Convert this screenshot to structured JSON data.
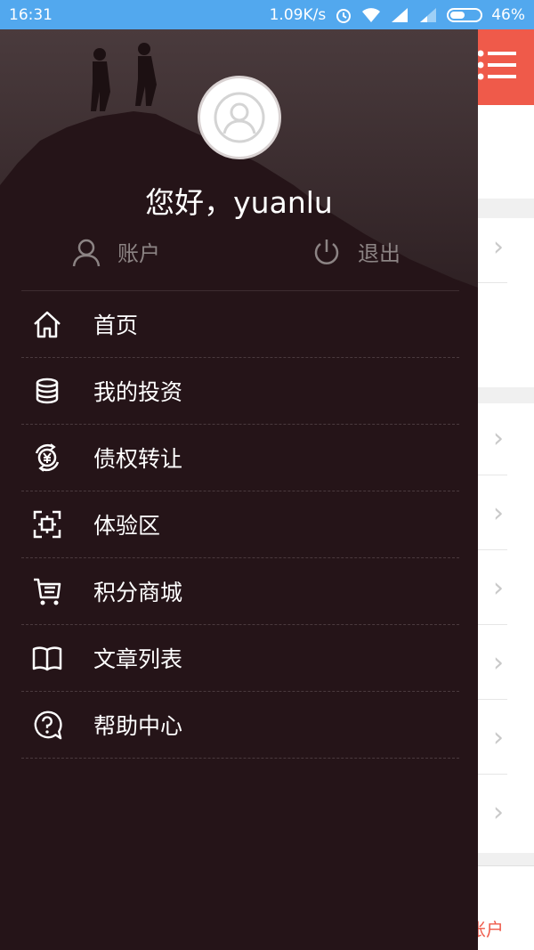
{
  "status_bar": {
    "time": "16:31",
    "network_speed": "1.09K/s",
    "battery": "46%",
    "icons": [
      "alarm-icon",
      "wifi-icon",
      "signal-icon",
      "signal-weak-icon",
      "battery-icon"
    ]
  },
  "drawer": {
    "greeting": "您好，yuanlu",
    "account_label": "账户",
    "logout_label": "退出",
    "menu": [
      {
        "label": "首页",
        "icon": "home-icon"
      },
      {
        "label": "我的投资",
        "icon": "coins-stack-icon"
      },
      {
        "label": "债权转让",
        "icon": "yen-transfer-icon"
      },
      {
        "label": "体验区",
        "icon": "scan-frame-icon"
      },
      {
        "label": "积分商城",
        "icon": "cart-icon"
      },
      {
        "label": "文章列表",
        "icon": "open-book-icon"
      },
      {
        "label": "帮助中心",
        "icon": "help-bubble-icon"
      }
    ]
  },
  "background_page": {
    "tab_label": "账户",
    "accent_color": "#ef5a4a"
  },
  "colors": {
    "drawer_bg": "#251418",
    "status_bar": "#52a8ee"
  }
}
